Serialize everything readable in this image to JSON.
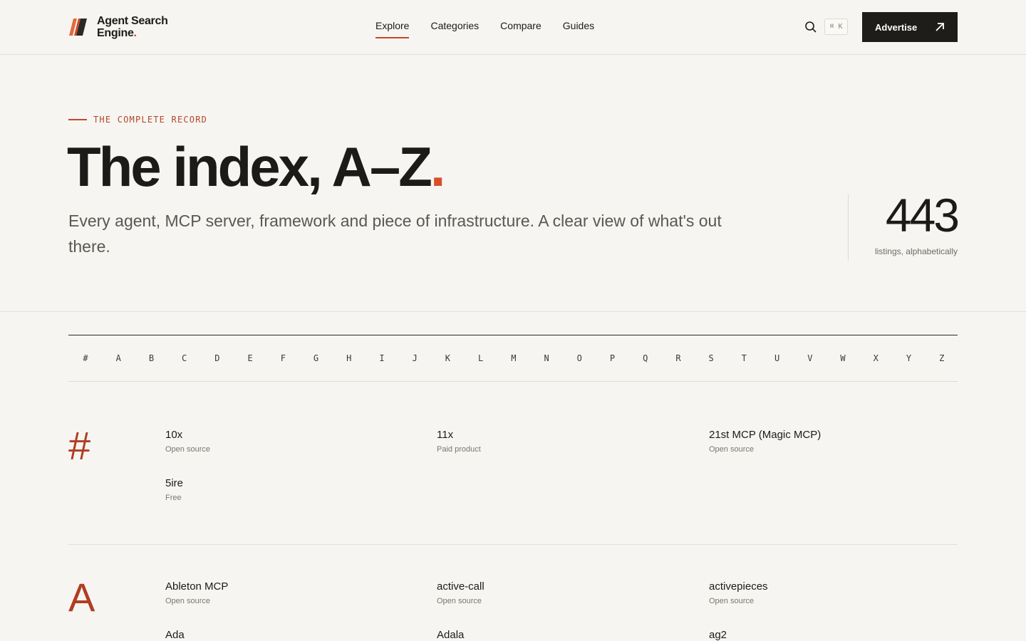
{
  "header": {
    "logo_line1": "Agent Search",
    "logo_line2": "Engine",
    "logo_dot": ".",
    "nav": [
      {
        "label": "Explore",
        "active": true
      },
      {
        "label": "Categories",
        "active": false
      },
      {
        "label": "Compare",
        "active": false
      },
      {
        "label": "Guides",
        "active": false
      }
    ],
    "shortcut": "⌘ K",
    "advertise_label": "Advertise",
    "accent": "#c5482a"
  },
  "hero": {
    "eyebrow": "THE COMPLETE RECORD",
    "title": "The index, A–Z",
    "title_dot": ".",
    "subtitle": "Every agent, MCP server, framework and piece of infrastructure. A clear view of what's out there.",
    "count": "443",
    "count_label": "listings, alphabetically"
  },
  "alphabet": [
    "#",
    "A",
    "B",
    "C",
    "D",
    "E",
    "F",
    "G",
    "H",
    "I",
    "J",
    "K",
    "L",
    "M",
    "N",
    "O",
    "P",
    "Q",
    "R",
    "S",
    "T",
    "U",
    "V",
    "W",
    "X",
    "Y",
    "Z"
  ],
  "sections": [
    {
      "letter": "#",
      "entries": [
        {
          "name": "10x",
          "type": "Open source"
        },
        {
          "name": "11x",
          "type": "Paid product"
        },
        {
          "name": "21st MCP (Magic MCP)",
          "type": "Open source"
        },
        {
          "name": "5ire",
          "type": "Free"
        }
      ]
    },
    {
      "letter": "A",
      "entries": [
        {
          "name": "Ableton MCP",
          "type": "Open source"
        },
        {
          "name": "active-call",
          "type": "Open source"
        },
        {
          "name": "activepieces",
          "type": "Open source"
        },
        {
          "name": "Ada",
          "type": ""
        },
        {
          "name": "Adala",
          "type": ""
        },
        {
          "name": "ag2",
          "type": ""
        }
      ]
    }
  ]
}
